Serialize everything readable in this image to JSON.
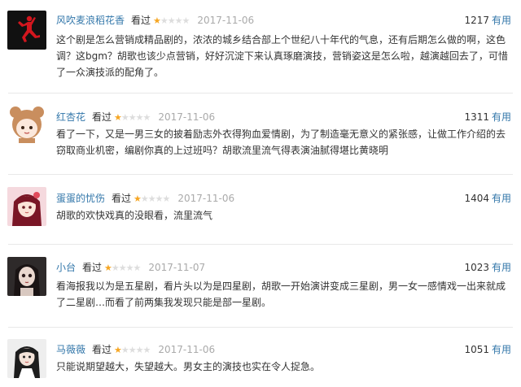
{
  "reviews": [
    {
      "user": "风吹麦浪稻花香",
      "watched_label": "看过",
      "rating": 1,
      "max_rating": 5,
      "date": "2017-11-06",
      "votes": "1217",
      "useful_label": "有用",
      "content": "这个剧是怎么营销成精品剧的，浓浓的城乡结合部上个世纪八十年代的气息，还有后期怎么做的啊，这色调？这bgm？胡歌也该少点营销，好好沉淀下来认真琢磨演技，营销姿这是怎么啦，越演越回去了，可惜了一众演技派的配角了。",
      "avatar": "jumpman-logo",
      "avatar_bg": "#111111",
      "avatar_fg": "#d3161e"
    },
    {
      "user": "红杏花",
      "watched_label": "看过",
      "rating": 1,
      "max_rating": 5,
      "date": "2017-11-06",
      "votes": "1311",
      "useful_label": "有用",
      "content": "看了一下，又是一男三女的披着励志外衣得狗血爱情剧，为了制造毫无意义的紧张感，让做工作介绍的去窃取商业机密，编剧你真的上过班吗？胡歌流里流气得表演油腻得堪比黄晓明",
      "avatar": "bear-hood-girl",
      "avatar_bg": "#f4e4d8",
      "avatar_fg": "#b07548"
    },
    {
      "user": "蛋蛋的忧伤",
      "watched_label": "看过",
      "rating": 1,
      "max_rating": 5,
      "date": "2017-11-06",
      "votes": "1404",
      "useful_label": "有用",
      "content": "胡歌的欢快戏真的没眼看，流里流气",
      "avatar": "anime-girl-red",
      "avatar_bg": "#f3d3d8",
      "avatar_fg": "#8a1f2c"
    },
    {
      "user": "小台",
      "watched_label": "看过",
      "rating": 1,
      "max_rating": 5,
      "date": "2017-11-07",
      "votes": "1023",
      "useful_label": "有用",
      "content": "看海报我以为是五星剧，看片头以为是四星剧，胡歌一开始演讲变成三星剧，男一女一感情戏一出来就成了二星剧…而看了前两集我发现只能是部一星剧。",
      "avatar": "doll-photo",
      "avatar_bg": "#3a3a3a",
      "avatar_fg": "#e8d8d0"
    },
    {
      "user": "马薇薇",
      "watched_label": "看过",
      "rating": 1,
      "max_rating": 5,
      "date": "2017-11-06",
      "votes": "1051",
      "useful_label": "有用",
      "content": "只能说期望越大，失望越大。男女主的演技也实在令人捉急。",
      "avatar": "girl-portrait",
      "avatar_bg": "#e9e9e9",
      "avatar_fg": "#222222"
    }
  ]
}
